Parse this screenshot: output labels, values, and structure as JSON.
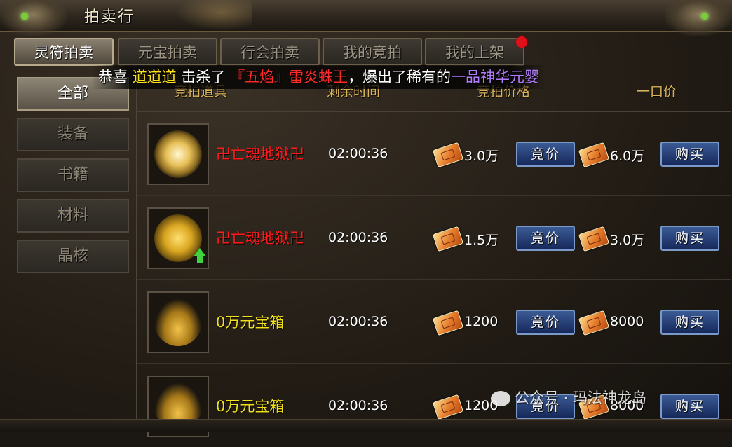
{
  "window": {
    "title": "拍卖行"
  },
  "tabs": [
    {
      "label": "灵符拍卖",
      "active": true
    },
    {
      "label": "元宝拍卖",
      "active": false
    },
    {
      "label": "行会拍卖",
      "active": false
    },
    {
      "label": "我的竞拍",
      "active": false
    },
    {
      "label": "我的上架",
      "active": false,
      "notification": true
    }
  ],
  "broadcast": {
    "prefix": "恭喜",
    "player": "道道道",
    "verb": "击杀了",
    "boss": "『五焰』雷炎蛛王",
    "middle": "，爆出了稀有的",
    "item": "一品神华元婴"
  },
  "sidebar": {
    "items": [
      {
        "label": "全部",
        "active": true
      },
      {
        "label": "装备",
        "active": false
      },
      {
        "label": "书籍",
        "active": false
      },
      {
        "label": "材料",
        "active": false
      },
      {
        "label": "晶核",
        "active": false
      }
    ]
  },
  "table": {
    "headers": {
      "item": "竞拍道具",
      "time": "剩余时间",
      "bid_price": "竞拍价格",
      "buyout": "一口价"
    },
    "bid_button": "竟价",
    "buy_button": "购买",
    "rows": [
      {
        "name": "卍亡魂地狱卍",
        "name_color": "red",
        "icon": "golden-flower-icon",
        "time": "02:00:36",
        "bid": "3.0万",
        "buyout": "6.0万"
      },
      {
        "name": "卍亡魂地狱卍",
        "name_color": "red",
        "icon": "golden-orb-icon",
        "upgrade": true,
        "time": "02:00:36",
        "bid": "1.5万",
        "buyout": "3.0万"
      },
      {
        "name": "0万元宝箱",
        "name_color": "yellow",
        "icon": "treasure-chest-icon",
        "time": "02:00:36",
        "bid": "1200",
        "buyout": "8000"
      },
      {
        "name": "0万元宝箱",
        "name_color": "yellow",
        "icon": "treasure-chest-icon",
        "time": "02:00:36",
        "bid": "1200",
        "buyout": "8000"
      }
    ]
  },
  "watermark": {
    "text": "公众号 · 玛法神龙岛"
  },
  "colors": {
    "player": "#ffe21a",
    "boss": "#ff2a2a",
    "rare_item": "#b27cff",
    "button": "#2a4a85"
  }
}
